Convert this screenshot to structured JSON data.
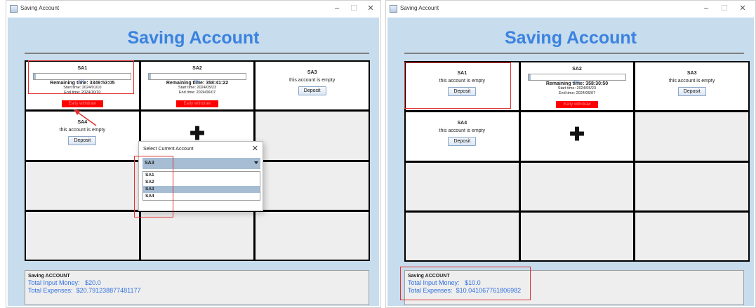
{
  "colors": {
    "accent": "#3b82e0",
    "highlight": "#e03030",
    "early_withdraw_bg": "#ff0000",
    "panel_bg": "#c7dcec"
  },
  "left": {
    "window_title": "Saving Account",
    "controls": {
      "minimize": "–",
      "maximize": "☐",
      "close": "✕"
    },
    "app_title": "Saving Account",
    "sa1": {
      "name": "SA1",
      "progress_text": "0%",
      "progress": 0.0,
      "remaining": "Remaining time: 3349:53:05",
      "start": "Start time: 2024/01/10",
      "end": "End time: 2024/10/10",
      "early_label": "Early withdraw"
    },
    "sa2": {
      "name": "SA2",
      "progress_text": "0%",
      "progress": 0.0,
      "remaining": "Remaining time: 358:41:22",
      "start": "Start time: 2024/05/23",
      "end": "End time: 2024/06/07",
      "early_label": "Early withdraw"
    },
    "sa3": {
      "name": "SA3",
      "status": "this account is empty",
      "deposit": "Deposit"
    },
    "sa4": {
      "name": "SA4",
      "status": "this account is empty",
      "deposit": "Deposit"
    },
    "add_symbol": "✚",
    "dialog": {
      "title": "Select Current Account",
      "close": "✕",
      "selected": "SA3",
      "options": [
        "SA1",
        "SA2",
        "SA3",
        "SA4"
      ]
    },
    "summary": {
      "title": "Saving ACCOUNT",
      "input_label": "Total Input Money:",
      "input_value": "$20.0",
      "expenses_label": "Total Expenses:",
      "expenses_value": "$20.791238877481177"
    }
  },
  "right": {
    "window_title": "Saving Account",
    "controls": {
      "minimize": "–",
      "maximize": "☐",
      "close": "✕"
    },
    "app_title": "Saving Account",
    "sa1": {
      "name": "SA1",
      "status": "this account is empty",
      "deposit": "Deposit"
    },
    "sa2": {
      "name": "SA2",
      "progress_text": "0%",
      "progress": 0.0,
      "remaining": "Remaining time: 358:30:50",
      "start": "Start time: 2024/05/23",
      "end": "End time: 2024/06/07",
      "early_label": "Early withdraw"
    },
    "sa3": {
      "name": "SA3",
      "status": "this account is empty",
      "deposit": "Deposit"
    },
    "sa4": {
      "name": "SA4",
      "status": "this account is empty",
      "deposit": "Deposit"
    },
    "add_symbol": "✚",
    "summary": {
      "title": "Saving ACCOUNT",
      "input_label": "Total Input Money:",
      "input_value": "$10.0",
      "expenses_label": "Total Expenses:",
      "expenses_value": "$10.041067761806982"
    }
  }
}
